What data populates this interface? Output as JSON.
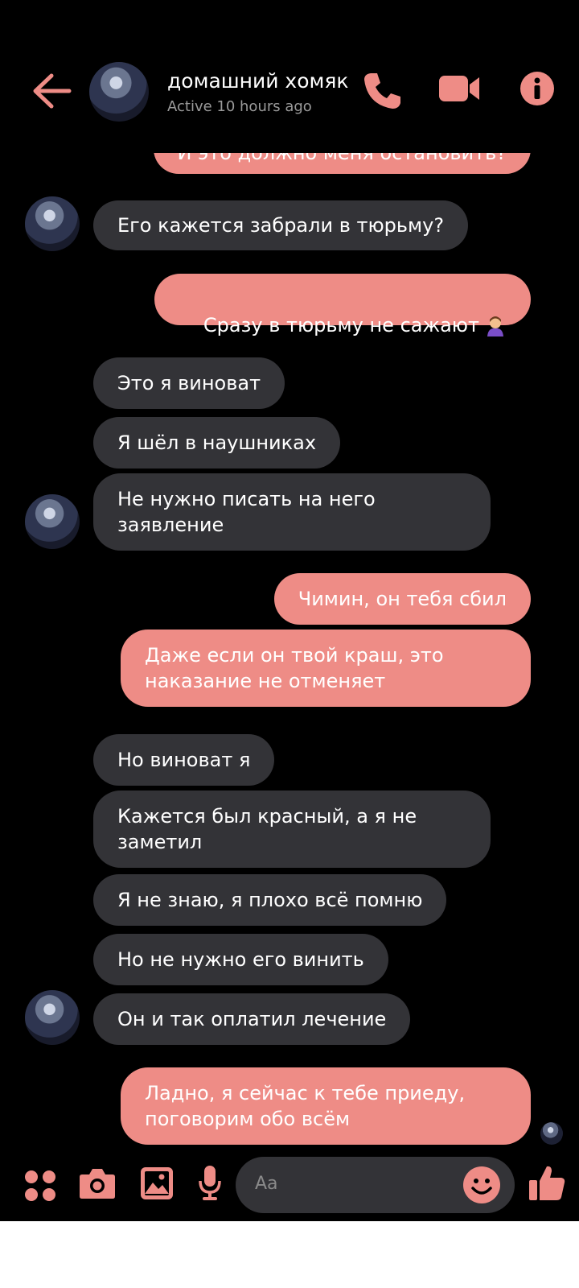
{
  "header": {
    "title": "домашний хомяк",
    "status": "Active 10 hours ago"
  },
  "messages": [
    {
      "side": "out",
      "text": "И это должно меня остановить?"
    },
    {
      "side": "in",
      "text": "Его кажется забрали в тюрьму?"
    },
    {
      "side": "out",
      "text": "Сразу в тюрьму не сажают"
    },
    {
      "side": "in",
      "text": "Это я виноват"
    },
    {
      "side": "in",
      "text": "Я шёл в наушниках"
    },
    {
      "side": "in",
      "text": "Не нужно писать на него\nзаявление"
    },
    {
      "side": "out",
      "text": "Чимин, он тебя сбил"
    },
    {
      "side": "out",
      "text": "Даже если он твой краш, это\nнаказание не отменяет"
    },
    {
      "side": "in",
      "text": "Но виноват я"
    },
    {
      "side": "in",
      "text": "Кажется был красный, а я не\nзаметил"
    },
    {
      "side": "in",
      "text": "Я не знаю, я плохо всё помню"
    },
    {
      "side": "in",
      "text": "Но не нужно его винить"
    },
    {
      "side": "in",
      "text": "Он и так оплатил лечение"
    },
    {
      "side": "out",
      "text": "Ладно, я сейчас к тебе приеду,\nпоговорим обо всём"
    }
  ],
  "composer": {
    "placeholder": "Aa"
  },
  "colors": {
    "accent": "#ee8c86",
    "incoming_bubble": "#333337",
    "background": "#000000"
  },
  "icons": [
    "back-arrow-icon",
    "phone-icon",
    "video-camera-icon",
    "info-icon",
    "apps-grid-icon",
    "camera-icon",
    "image-icon",
    "microphone-icon",
    "smiley-icon",
    "thumbs-up-icon"
  ]
}
